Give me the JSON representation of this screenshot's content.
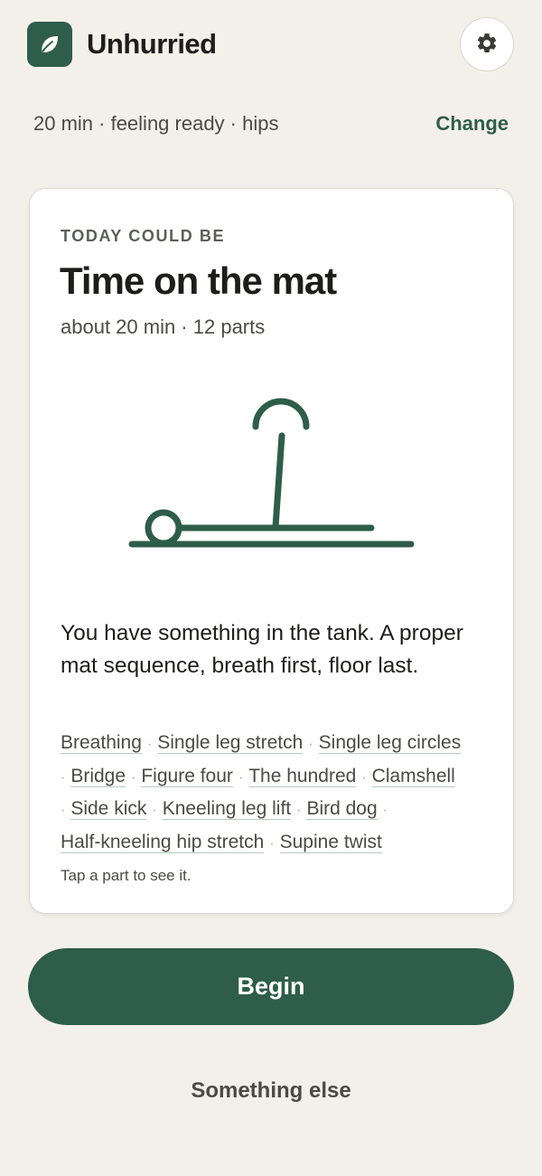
{
  "app": {
    "title": "Unhurried",
    "logo_icon": "leaf-icon",
    "settings_icon": "gear-icon"
  },
  "summary": {
    "text": "20 min · feeling ready · hips",
    "change_label": "Change"
  },
  "card": {
    "eyebrow": "TODAY COULD BE",
    "title": "Time on the mat",
    "meta": "about 20 min · 12 parts",
    "illustration_icon": "mat-exercise-illustration",
    "description": "You have something in the tank. A proper mat sequence, breath first, floor last.",
    "parts": [
      "Breathing",
      "Single leg stretch",
      "Single leg circles",
      "Bridge",
      "Figure four",
      "The hundred",
      "Clamshell",
      "Side kick",
      "Kneeling leg lift",
      "Bird dog",
      "Half-kneeling hip stretch",
      "Supine twist"
    ],
    "hint": "Tap a part to see it."
  },
  "actions": {
    "begin_label": "Begin",
    "else_label": "Something else"
  },
  "colors": {
    "accent": "#2e5d4b",
    "background": "#f3f0e9",
    "card": "#ffffff",
    "text": "#1d1d1b",
    "muted_text": "#4a4a45"
  }
}
